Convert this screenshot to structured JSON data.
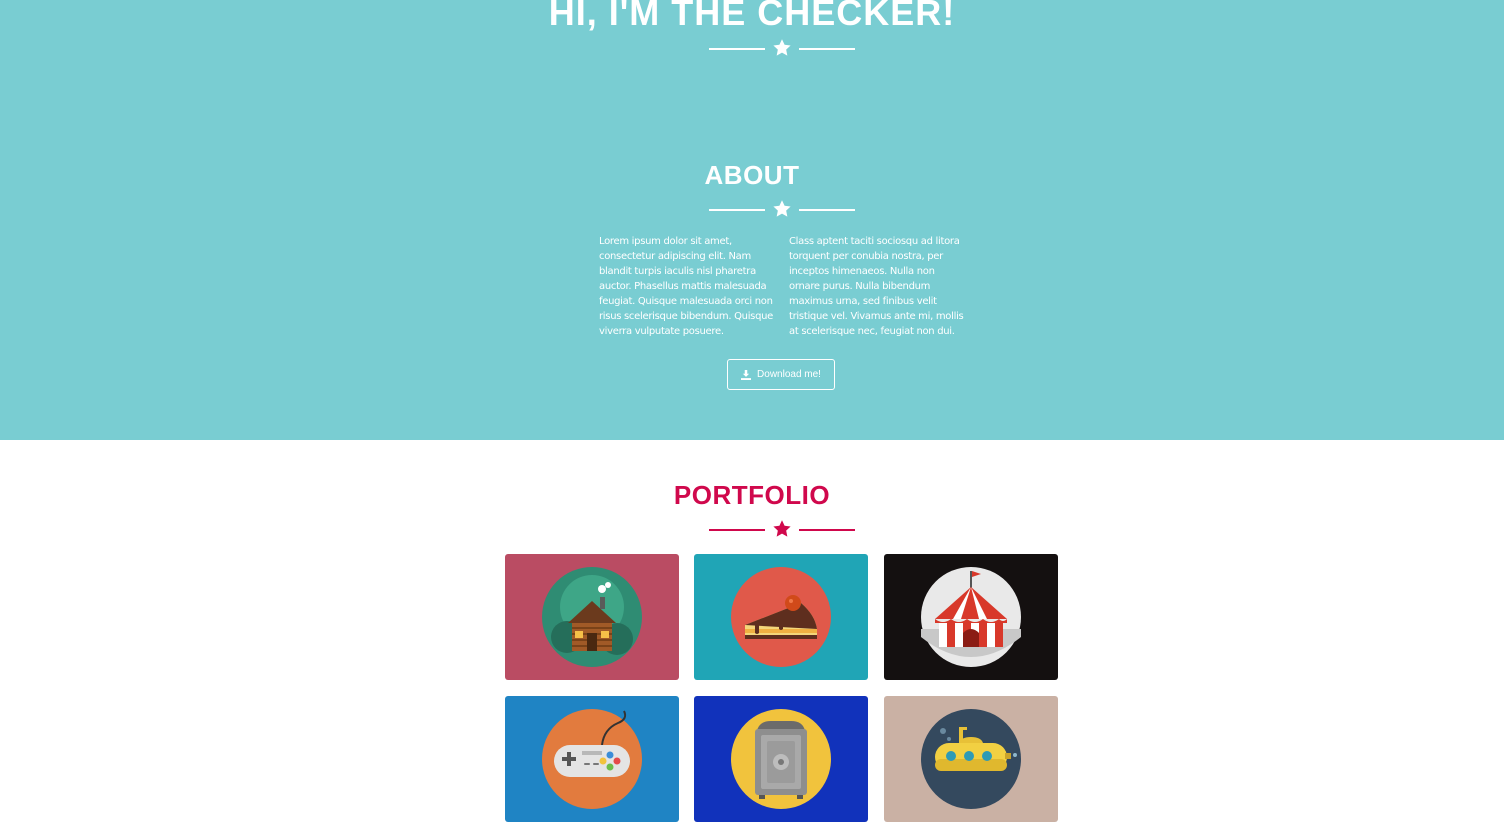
{
  "hero": {
    "title": "HI, I'M THE CHECKER!"
  },
  "about": {
    "title": "ABOUT",
    "col_left": "Lorem ipsum dolor sit amet, consectetur adipiscing elit. Nam blandit turpis iaculis nisl pharetra auctor. Phasellus mattis malesuada feugiat. Quisque malesuada orci non risus scelerisque bibendum. Quisque viverra vulputate posuere.",
    "col_right": "Class aptent taciti sociosqu ad litora torquent per conubia nostra, per inceptos himenaeos. Nulla non ornare purus. Nulla bibendum maximus urna, sed finibus velit tristique vel. Vivamus ante mi, mollis at scelerisque nec, feugiat non dui.",
    "download_label": "Download me!"
  },
  "portfolio": {
    "title": "PORTFOLIO",
    "items": [
      {
        "icon": "cabin-icon",
        "bg": "#ba4c63"
      },
      {
        "icon": "cake-icon",
        "bg": "#20a5b6"
      },
      {
        "icon": "circus-tent-icon",
        "bg": "#141010"
      },
      {
        "icon": "game-controller-icon",
        "bg": "#1f84c4"
      },
      {
        "icon": "safe-icon",
        "bg": "#1132bb"
      },
      {
        "icon": "submarine-icon",
        "bg": "#cab1a4"
      }
    ]
  },
  "colors": {
    "hero_bg": "#79cdd2",
    "accent": "#d0084c",
    "white": "#ffffff"
  }
}
